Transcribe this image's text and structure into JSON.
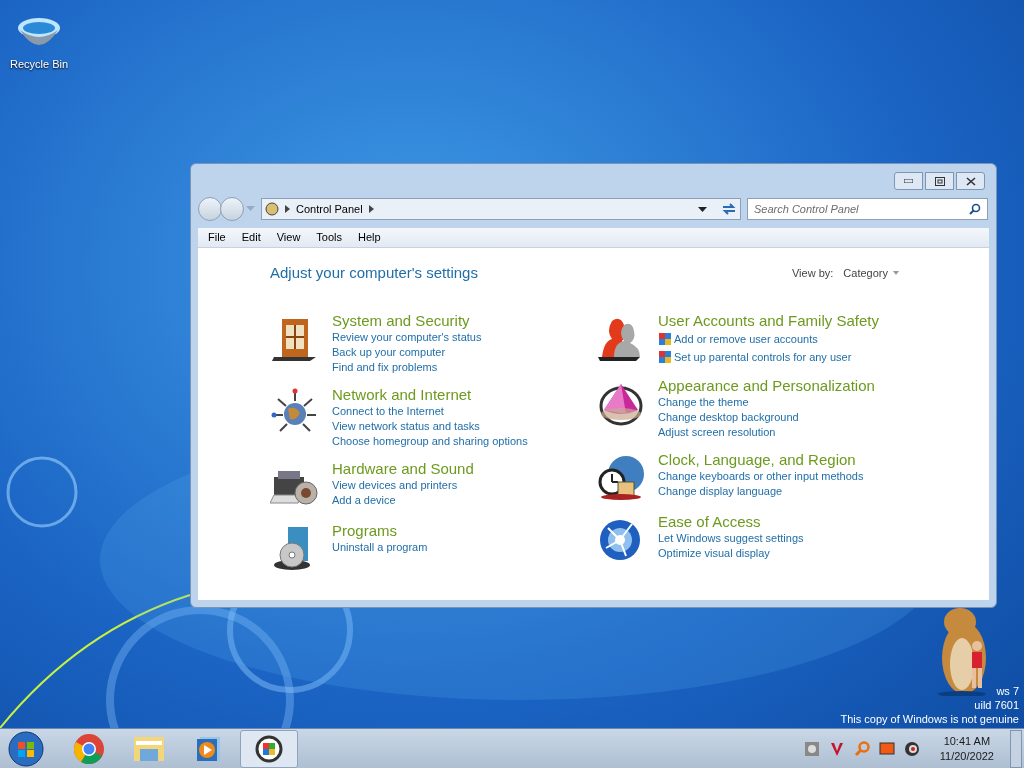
{
  "desktop_icons": [
    {
      "label": "Recycle Bin"
    }
  ],
  "window": {
    "address": {
      "crumbs": [
        "Control Panel"
      ]
    },
    "search": {
      "placeholder": "Search Control Panel"
    },
    "menu": [
      "File",
      "Edit",
      "View",
      "Tools",
      "Help"
    ],
    "heading": "Adjust your computer's settings",
    "view_by": {
      "label": "View by:",
      "value": "Category"
    },
    "columns": [
      [
        {
          "title": "System and Security",
          "links": [
            {
              "text": "Review your computer's status",
              "shielded": false
            },
            {
              "text": "Back up your computer",
              "shielded": false
            },
            {
              "text": "Find and fix problems",
              "shielded": false
            }
          ]
        },
        {
          "title": "Network and Internet",
          "links": [
            {
              "text": "Connect to the Internet",
              "shielded": false
            },
            {
              "text": "View network status and tasks",
              "shielded": false
            },
            {
              "text": "Choose homegroup and sharing options",
              "shielded": false
            }
          ]
        },
        {
          "title": "Hardware and Sound",
          "links": [
            {
              "text": "View devices and printers",
              "shielded": false
            },
            {
              "text": "Add a device",
              "shielded": false
            }
          ]
        },
        {
          "title": "Programs",
          "links": [
            {
              "text": "Uninstall a program",
              "shielded": false
            }
          ]
        }
      ],
      [
        {
          "title": "User Accounts and Family Safety",
          "links": [
            {
              "text": "Add or remove user accounts",
              "shielded": true
            },
            {
              "text": "Set up parental controls for any user",
              "shielded": true
            }
          ]
        },
        {
          "title": "Appearance and Personalization",
          "links": [
            {
              "text": "Change the theme",
              "shielded": false
            },
            {
              "text": "Change desktop background",
              "shielded": false
            },
            {
              "text": "Adjust screen resolution",
              "shielded": false
            }
          ]
        },
        {
          "title": "Clock, Language, and Region",
          "links": [
            {
              "text": "Change keyboards or other input methods",
              "shielded": false
            },
            {
              "text": "Change display language",
              "shielded": false
            }
          ]
        },
        {
          "title": "Ease of Access",
          "links": [
            {
              "text": "Let Windows suggest settings",
              "shielded": false
            },
            {
              "text": "Optimize visual display",
              "shielded": false
            }
          ]
        }
      ]
    ]
  },
  "watermark": [
    "ws 7",
    "uild 7601",
    "This copy of Windows is not genuine"
  ],
  "taskbar": {
    "items": [
      {
        "selected": false
      },
      {
        "selected": false
      },
      {
        "selected": false
      },
      {
        "selected": true
      }
    ],
    "clock": {
      "time": "10:41 AM",
      "date": "11/20/2022"
    }
  }
}
